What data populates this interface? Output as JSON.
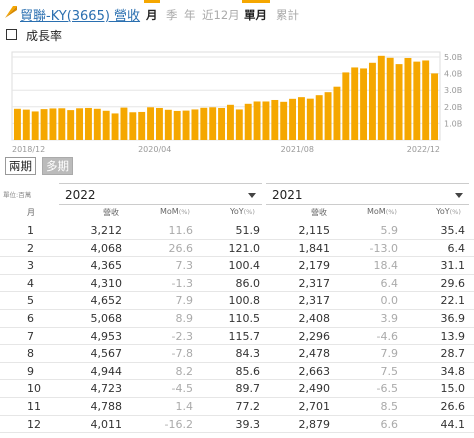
{
  "header": {
    "title": "貿聯-KY(3665) 營收",
    "tabs": [
      {
        "label": "月",
        "active": true
      },
      {
        "label": "季",
        "active": false
      },
      {
        "label": "年",
        "active": false
      },
      {
        "label": "近12月",
        "active": false
      },
      {
        "label": "單月",
        "active": true
      },
      {
        "label": "累計",
        "active": false
      }
    ]
  },
  "growth_toggle": {
    "label": "成長率",
    "checked": false
  },
  "chart_data": {
    "type": "bar",
    "color": "#f5a700",
    "x_ticks": [
      "2018/12",
      "2020/04",
      "2021/08",
      "2022/12"
    ],
    "y_ticks": [
      "0",
      "1.0B",
      "2.0B",
      "3.0B",
      "4.0B",
      "5.0B"
    ],
    "ylim": [
      0,
      5.3
    ],
    "values": [
      1.88,
      1.83,
      1.72,
      1.86,
      1.9,
      1.91,
      1.8,
      1.91,
      1.93,
      1.88,
      1.76,
      1.6,
      1.95,
      1.67,
      1.69,
      1.97,
      1.93,
      1.82,
      1.75,
      1.77,
      1.84,
      1.94,
      1.97,
      1.93,
      2.12,
      1.84,
      2.18,
      2.32,
      2.32,
      2.41,
      2.3,
      2.48,
      2.58,
      2.49,
      2.7,
      2.88,
      3.21,
      4.07,
      4.37,
      4.31,
      4.65,
      5.07,
      4.95,
      4.57,
      4.94,
      4.72,
      4.79,
      4.01
    ]
  },
  "period_tabs": [
    {
      "label": "兩期",
      "active": true
    },
    {
      "label": "多期",
      "active": false
    }
  ],
  "unit_label": "單位:百萬",
  "table": {
    "month_header": "月",
    "years": [
      "2022",
      "2021"
    ],
    "col_revenue": "營收",
    "col_mom": "MoM",
    "col_yoy": "YoY",
    "pct": "(%)",
    "rows": [
      {
        "m": "1",
        "a_rev": "3,212",
        "a_mom": "11.6",
        "a_yoy": "51.9",
        "b_rev": "2,115",
        "b_mom": "5.9",
        "b_yoy": "35.4"
      },
      {
        "m": "2",
        "a_rev": "4,068",
        "a_mom": "26.6",
        "a_yoy": "121.0",
        "b_rev": "1,841",
        "b_mom": "-13.0",
        "b_yoy": "6.4"
      },
      {
        "m": "3",
        "a_rev": "4,365",
        "a_mom": "7.3",
        "a_yoy": "100.4",
        "b_rev": "2,179",
        "b_mom": "18.4",
        "b_yoy": "31.1"
      },
      {
        "m": "4",
        "a_rev": "4,310",
        "a_mom": "-1.3",
        "a_yoy": "86.0",
        "b_rev": "2,317",
        "b_mom": "6.4",
        "b_yoy": "29.6"
      },
      {
        "m": "5",
        "a_rev": "4,652",
        "a_mom": "7.9",
        "a_yoy": "100.8",
        "b_rev": "2,317",
        "b_mom": "0.0",
        "b_yoy": "22.1"
      },
      {
        "m": "6",
        "a_rev": "5,068",
        "a_mom": "8.9",
        "a_yoy": "110.5",
        "b_rev": "2,408",
        "b_mom": "3.9",
        "b_yoy": "36.9"
      },
      {
        "m": "7",
        "a_rev": "4,953",
        "a_mom": "-2.3",
        "a_yoy": "115.7",
        "b_rev": "2,296",
        "b_mom": "-4.6",
        "b_yoy": "13.9"
      },
      {
        "m": "8",
        "a_rev": "4,567",
        "a_mom": "-7.8",
        "a_yoy": "84.3",
        "b_rev": "2,478",
        "b_mom": "7.9",
        "b_yoy": "28.7"
      },
      {
        "m": "9",
        "a_rev": "4,944",
        "a_mom": "8.2",
        "a_yoy": "85.6",
        "b_rev": "2,663",
        "b_mom": "7.5",
        "b_yoy": "34.8"
      },
      {
        "m": "10",
        "a_rev": "4,723",
        "a_mom": "-4.5",
        "a_yoy": "89.7",
        "b_rev": "2,490",
        "b_mom": "-6.5",
        "b_yoy": "15.0"
      },
      {
        "m": "11",
        "a_rev": "4,788",
        "a_mom": "1.4",
        "a_yoy": "77.2",
        "b_rev": "2,701",
        "b_mom": "8.5",
        "b_yoy": "26.6"
      },
      {
        "m": "12",
        "a_rev": "4,011",
        "a_mom": "-16.2",
        "a_yoy": "39.3",
        "b_rev": "2,879",
        "b_mom": "6.6",
        "b_yoy": "44.1"
      }
    ]
  }
}
